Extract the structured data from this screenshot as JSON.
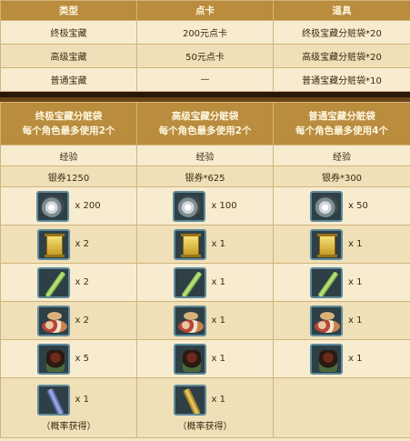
{
  "top_table": {
    "headers": [
      "类型",
      "点卡",
      "道具"
    ],
    "rows": [
      [
        "终极宝藏",
        "200元点卡",
        "终极宝藏分赃袋*20"
      ],
      [
        "高级宝藏",
        "50元点卡",
        "高级宝藏分赃袋*20"
      ],
      [
        "普通宝藏",
        "—",
        "普通宝藏分赃袋*10"
      ]
    ]
  },
  "bag_table": {
    "headers": [
      {
        "title": "终极宝藏分赃袋",
        "sub": "每个角色最多使用2个"
      },
      {
        "title": "高级宝藏分赃袋",
        "sub": "每个角色最多使用2个"
      },
      {
        "title": "普通宝藏分赃袋",
        "sub": "每个角色最多使用4个"
      }
    ],
    "exp_row": [
      "经验",
      "经验",
      "经验"
    ],
    "silver_row": [
      "银券1250",
      "银券*625",
      "银券*300"
    ],
    "item_rows": [
      {
        "icon": "swirl-orb-icon",
        "qty": [
          "x 200",
          "x 100",
          "x 50"
        ]
      },
      {
        "icon": "golden-scroll-icon",
        "qty": [
          "x 2",
          "x 1",
          "x 1"
        ]
      },
      {
        "icon": "bamboo-scroll-icon",
        "qty": [
          "x 2",
          "x 1",
          "x 1"
        ]
      },
      {
        "icon": "food-platter-icon",
        "qty": [
          "x 2",
          "x 1",
          "x 1"
        ]
      },
      {
        "icon": "armor-icon",
        "qty": [
          "x 5",
          "x 1",
          "x 1"
        ]
      },
      {
        "icon": "sword-icon",
        "qty": [
          "x 1",
          "x 1",
          ""
        ],
        "note": [
          "（概率获得）",
          "（概率获得）",
          ""
        ]
      }
    ]
  },
  "colors": {
    "header_bg": "#b98c3e",
    "row_light": "#f7ecd0",
    "row_dark": "#efe0b8",
    "border": "#d2b47a",
    "divider": "#2a1707"
  }
}
